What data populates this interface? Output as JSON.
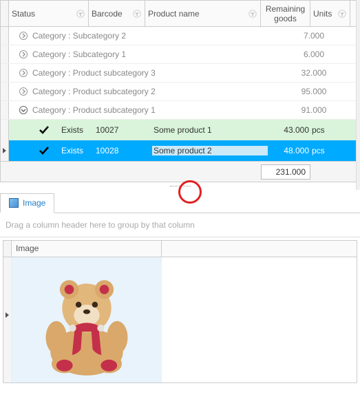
{
  "columns": {
    "status": "Status",
    "barcode": "Barcode",
    "product": "Product name",
    "remaining": "Remaining goods",
    "units": "Units"
  },
  "groups": [
    {
      "label": "Category : Subcategory 2",
      "value": "7.000",
      "expanded": false
    },
    {
      "label": "Category : Subcategory 1",
      "value": "6.000",
      "expanded": false
    },
    {
      "label": "Category : Product subcategory 3",
      "value": "32.000",
      "expanded": false
    },
    {
      "label": "Category : Product subcategory 2",
      "value": "95.000",
      "expanded": false
    },
    {
      "label": "Category : Product subcategory 1",
      "value": "91.000",
      "expanded": true
    }
  ],
  "rows": [
    {
      "status": "Exists",
      "barcode": "10027",
      "product": "Some product 1",
      "remaining": "43.000",
      "units": "pcs"
    },
    {
      "status": "Exists",
      "barcode": "10028",
      "product": "Some product 2",
      "remaining": "48.000",
      "units": "pcs"
    }
  ],
  "total": "231.000",
  "tab": {
    "label": "Image"
  },
  "groupHint": "Drag a column header here to group by that column",
  "bottomCol": "Image"
}
